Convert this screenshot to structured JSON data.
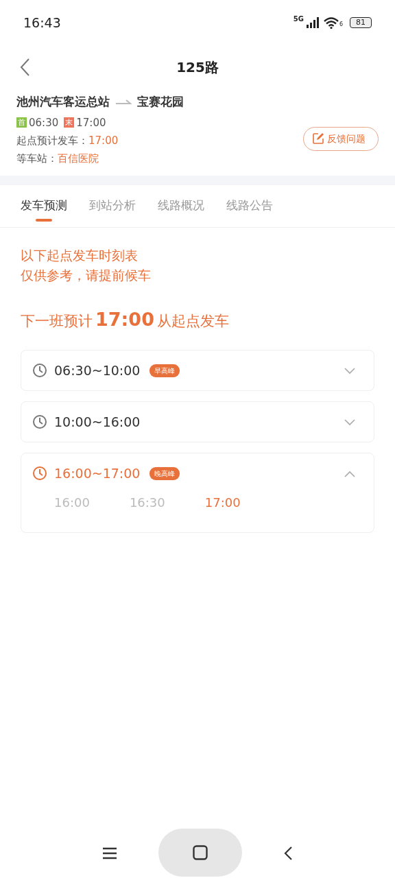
{
  "status_bar": {
    "time": "16:43",
    "network": "5G",
    "wifi_label": "6",
    "battery": "81"
  },
  "header": {
    "title": "125路"
  },
  "route": {
    "from": "池州汽车客运总站",
    "to": "宝赛花园",
    "first": {
      "tag": "首",
      "time": "06:30"
    },
    "last": {
      "tag": "末",
      "time": "17:00"
    },
    "depart_label": "起点预计发车：",
    "depart_time": "17:00",
    "stop_label": "等车站：",
    "stop": "百信医院",
    "feedback": "反馈问题"
  },
  "tabs": [
    {
      "label": "发车预测",
      "selected": true
    },
    {
      "label": "到站分析",
      "selected": false
    },
    {
      "label": "线路概况",
      "selected": false
    },
    {
      "label": "线路公告",
      "selected": false
    }
  ],
  "notice": [
    "以下起点发车时刻表",
    "仅供参考，请提前候车"
  ],
  "next_departure": {
    "prefix": "下一班预计",
    "time": "17:00",
    "suffix": "从起点发车"
  },
  "periods": [
    {
      "range": "06:30~10:00",
      "tag": "早高峰",
      "current": false,
      "expanded": false
    },
    {
      "range": "10:00~16:00",
      "current": false,
      "expanded": false
    },
    {
      "range": "16:00~17:00",
      "tag": "晚高峰",
      "current": true,
      "expanded": true,
      "times": [
        {
          "time": "16:00",
          "selected": false
        },
        {
          "time": "16:30",
          "selected": false
        },
        {
          "time": "17:00",
          "selected": true
        }
      ]
    }
  ]
}
